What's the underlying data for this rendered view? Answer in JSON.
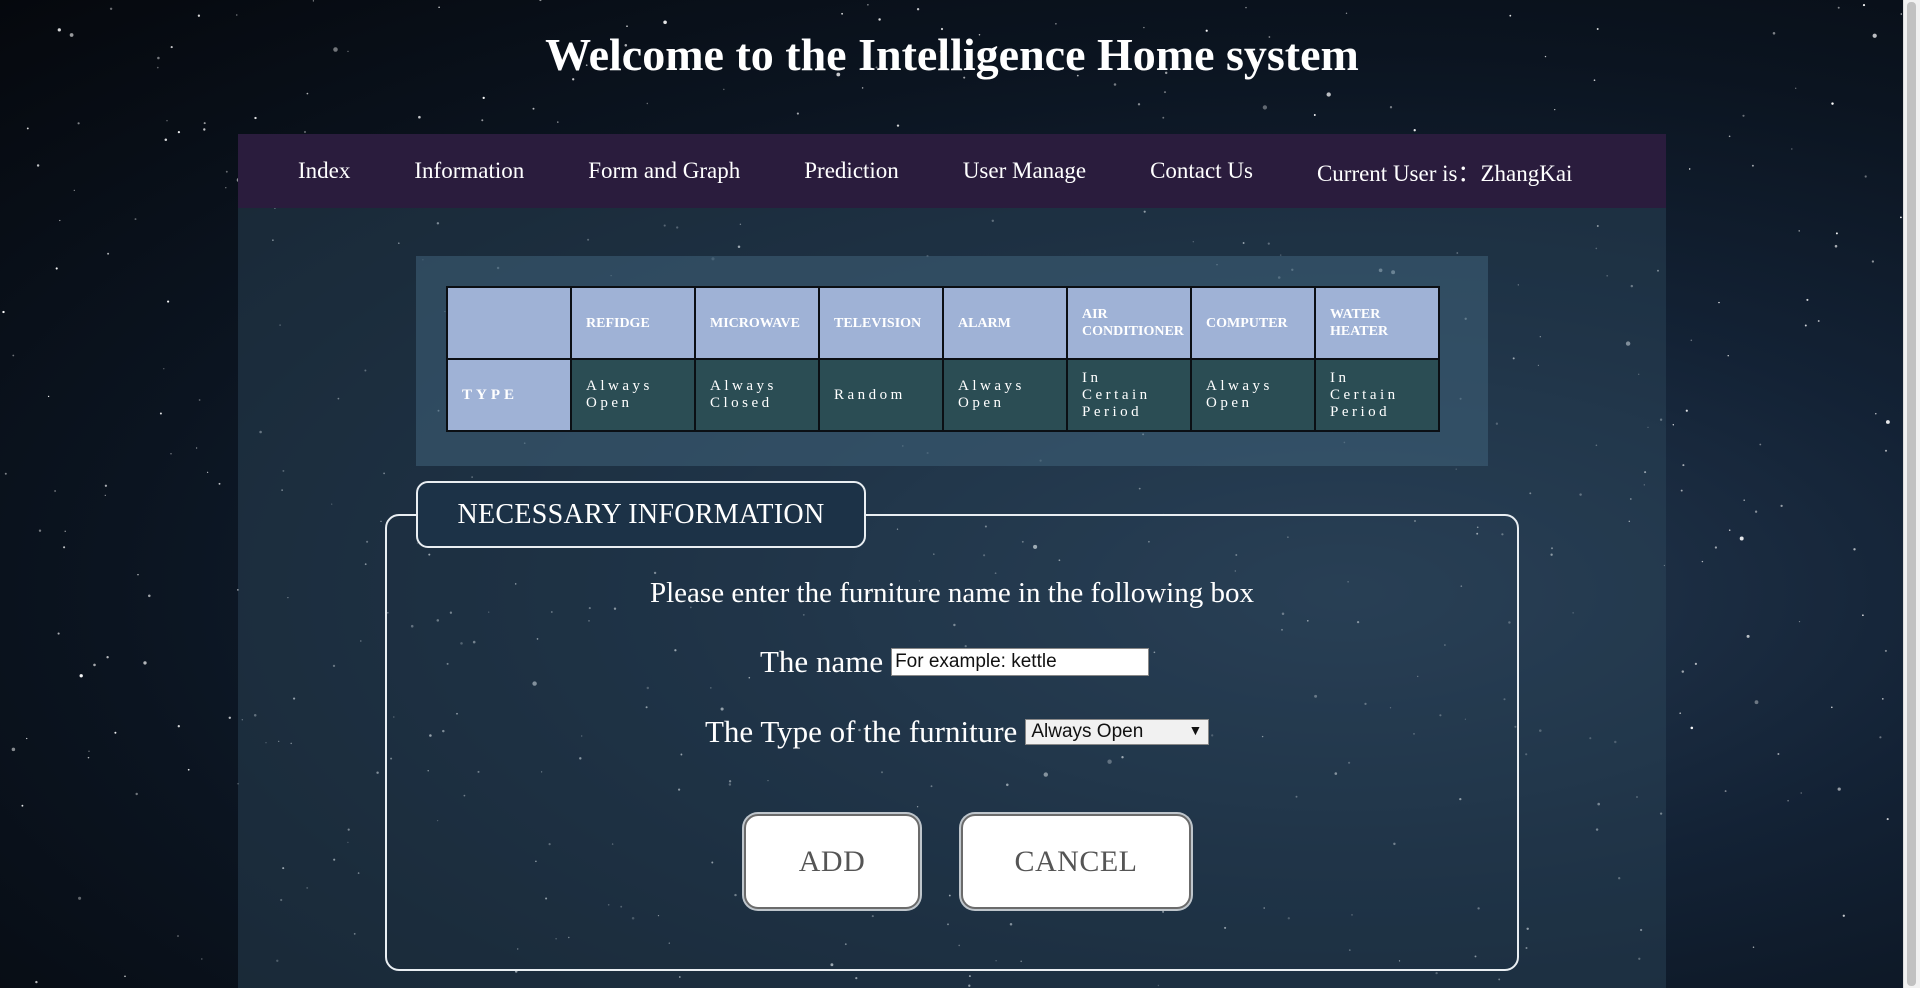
{
  "header": {
    "title": "Welcome to the Intelligence Home system"
  },
  "nav": {
    "items": [
      {
        "label": "Index"
      },
      {
        "label": "Information"
      },
      {
        "label": "Form and Graph"
      },
      {
        "label": "Prediction"
      },
      {
        "label": "User Manage"
      },
      {
        "label": "Contact Us"
      },
      {
        "label": "Current User is：ZhangKai"
      }
    ]
  },
  "device_table": {
    "corner": "",
    "row_label": "TYPE",
    "columns": [
      {
        "name": "REFIDGE",
        "type": "Always Open"
      },
      {
        "name": "MICROWAVE",
        "type": "Always Closed"
      },
      {
        "name": "TELEVISION",
        "type": "Random"
      },
      {
        "name": "ALARM",
        "type": "Always Open"
      },
      {
        "name": "AIR CONDITIONER",
        "type": "In Certain Period"
      },
      {
        "name": "COMPUTER",
        "type": "Always Open"
      },
      {
        "name": "WATER HEATER",
        "type": "In Certain Period"
      }
    ]
  },
  "form": {
    "legend": "NECESSARY INFORMATION",
    "prompt": "Please enter the furniture name in the following box",
    "name_label": "The name",
    "name_value": "For example: kettle",
    "type_label": "The Type of the furniture",
    "type_selected": "Always Open",
    "add_label": "ADD",
    "cancel_label": "CANCEL"
  },
  "colors": {
    "nav_bg": "#2a1c3d",
    "header_cell": "#9fb2d6",
    "value_cell": "#2f525a",
    "background": "#0b1420"
  }
}
